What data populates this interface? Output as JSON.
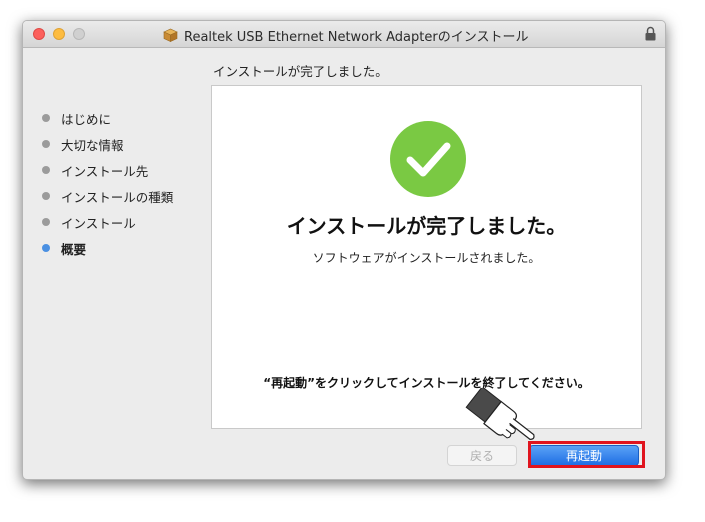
{
  "window": {
    "title": "Realtek USB Ethernet Network Adapterのインストール",
    "traffic_lights": [
      "close",
      "minimize",
      "zoom"
    ],
    "title_icon": "package-icon",
    "lock_icon": "lock-icon"
  },
  "heading": "インストールが完了しました。",
  "sidebar": {
    "items": [
      {
        "label": "はじめに",
        "active": false
      },
      {
        "label": "大切な情報",
        "active": false
      },
      {
        "label": "インストール先",
        "active": false
      },
      {
        "label": "インストールの種類",
        "active": false
      },
      {
        "label": "インストール",
        "active": false
      },
      {
        "label": "概要",
        "active": true
      }
    ]
  },
  "panel": {
    "icon": "checkmark-icon",
    "title": "インストールが完了しました。",
    "subtitle": "ソフトウェアがインストールされました。",
    "instruction": "“再起動”をクリックしてインストールを終了してください。"
  },
  "buttons": {
    "back_label": "戻る",
    "back_enabled": false,
    "restart_label": "再起動"
  },
  "annotation": {
    "pointer_icon": "hand-pointer-icon",
    "highlight_color": "#e0141e"
  },
  "colors": {
    "check_green": "#7ac943",
    "active_dot": "#4a90e2",
    "primary_button": "#2f80ed"
  }
}
